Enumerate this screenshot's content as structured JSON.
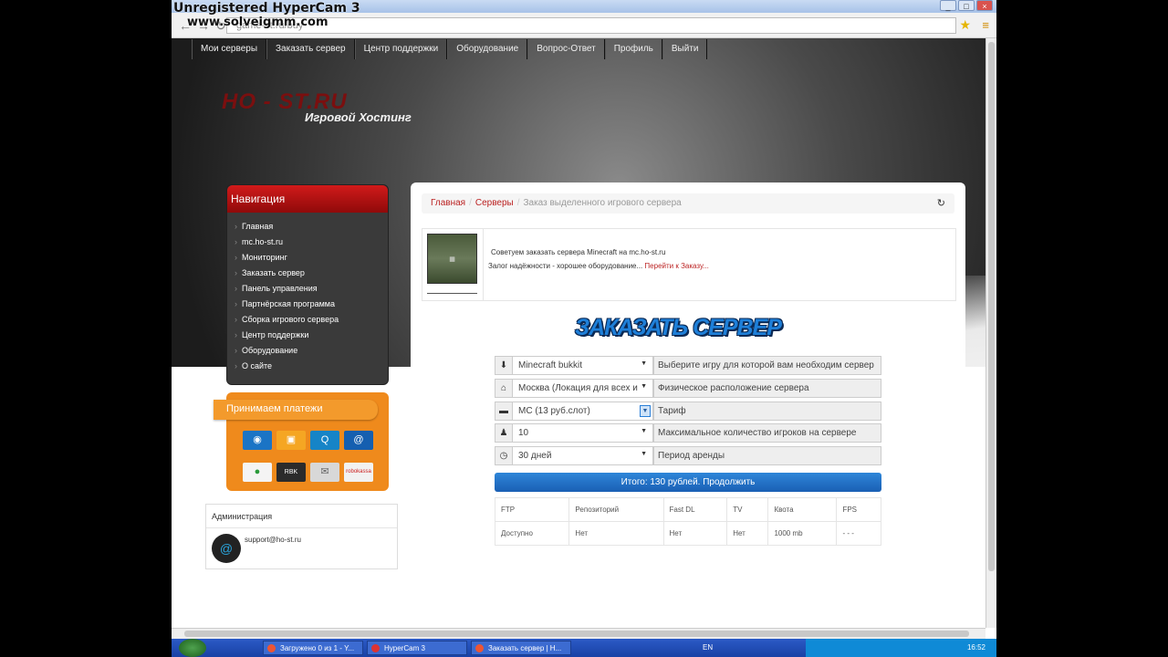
{
  "watermark": {
    "line1": "Unregistered HyperCam 3",
    "line2": "www.solveigmm.com"
  },
  "browser": {
    "url": "game-st.ru/buy",
    "window_controls": [
      "_",
      "□",
      "×"
    ],
    "star_icon": "★",
    "menu_icon": "≡"
  },
  "topnav": {
    "items": [
      "Мои серверы",
      "Заказать сервер",
      "Центр поддержки",
      "Оборудование",
      "Вопрос-Ответ",
      "Профиль",
      "Выйти"
    ]
  },
  "logo": {
    "main": "HO - ST.RU",
    "sub": "Игровой Хостинг"
  },
  "sidebar": {
    "title": "Навигация",
    "items": [
      "Главная",
      "mc.ho-st.ru",
      "Мониторинг",
      "Заказать сервер",
      "Панель управления",
      "Партнёрская программа",
      "Сборка игрового сервера",
      "Центр поддержки",
      "Оборудование",
      "О сайте"
    ]
  },
  "payments": {
    "title": "Принимаем платежи",
    "icons": [
      {
        "name": "webmoney-icon",
        "color": "#1b74c5",
        "glyph": "◉"
      },
      {
        "name": "yandex-money-icon",
        "color": "#f5a623",
        "glyph": "▣"
      },
      {
        "name": "qiwi-icon",
        "color": "#1684c7",
        "glyph": "Q"
      },
      {
        "name": "mailru-money-icon",
        "color": "#155fb0",
        "glyph": "@"
      },
      {
        "name": "sberbank-icon",
        "color": "#f4f4f4",
        "glyph": "●"
      },
      {
        "name": "rbk-money-icon",
        "color": "#2b2b2b",
        "glyph": "RBK"
      },
      {
        "name": "bank-transfer-icon",
        "color": "#d8d8d8",
        "glyph": "✉"
      },
      {
        "name": "robokassa-icon",
        "color": "#f2f2f2",
        "glyph": "robokassa"
      }
    ]
  },
  "admin": {
    "title": "Администрация",
    "email": "support@ho-st.ru"
  },
  "breadcrumb": {
    "home": "Главная",
    "servers": "Серверы",
    "current": "Заказ выделенного игрового сервера"
  },
  "promo": {
    "text1": "Советуем заказать сервера Minecraft на mc.ho-st.ru",
    "text2": "Залог надёжности - хорошее оборудование...",
    "link": "Перейти к Заказу..."
  },
  "order": {
    "title": "ЗАКАЗАТЬ СЕРВЕР",
    "rows": [
      {
        "icon": "⬇",
        "value": "Minecraft bukkit",
        "label": "Выберите игру для которой вам необходим сервер"
      },
      {
        "icon": "⌂",
        "value": "Москва (Локация для всех и",
        "label": "Физическое расположение сервера"
      },
      {
        "icon": "▬",
        "value": "МС (13 руб.слот)",
        "label": "Тариф"
      },
      {
        "icon": "♟",
        "value": "10",
        "label": "Максимальное количество игроков на сервере"
      },
      {
        "icon": "◷",
        "value": "30 дней",
        "label": "Период аренды"
      }
    ],
    "total": "Итого: 130 рублей. Продолжить"
  },
  "specs": {
    "headers": [
      "FTP",
      "Репозиторий",
      "Fast DL",
      "TV",
      "Квота",
      "FPS"
    ],
    "values": [
      "Доступно",
      "Нет",
      "Нет",
      "Нет",
      "1000 mb",
      "- - -"
    ]
  },
  "taskbar": {
    "items": [
      {
        "label": "Загружено 0 из 1 - Y...",
        "color": "#e53"
      },
      {
        "label": "HyperCam 3",
        "color": "#d33"
      },
      {
        "label": "Заказать сервер | H...",
        "color": "#e53"
      }
    ],
    "lang": "EN",
    "clock": "16:52"
  }
}
